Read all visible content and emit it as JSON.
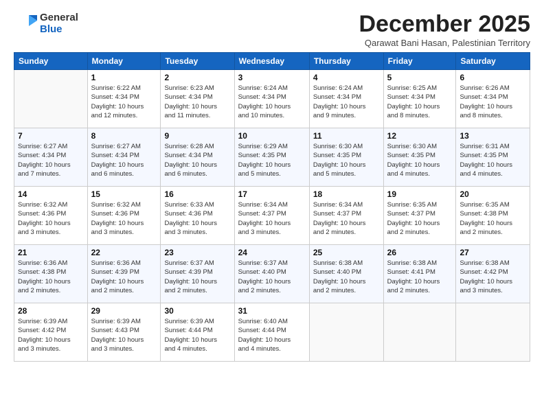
{
  "logo": {
    "general": "General",
    "blue": "Blue"
  },
  "title": "December 2025",
  "location": "Qarawat Bani Hasan, Palestinian Territory",
  "days_of_week": [
    "Sunday",
    "Monday",
    "Tuesday",
    "Wednesday",
    "Thursday",
    "Friday",
    "Saturday"
  ],
  "weeks": [
    [
      {
        "day": "",
        "info": ""
      },
      {
        "day": "1",
        "info": "Sunrise: 6:22 AM\nSunset: 4:34 PM\nDaylight: 10 hours\nand 12 minutes."
      },
      {
        "day": "2",
        "info": "Sunrise: 6:23 AM\nSunset: 4:34 PM\nDaylight: 10 hours\nand 11 minutes."
      },
      {
        "day": "3",
        "info": "Sunrise: 6:24 AM\nSunset: 4:34 PM\nDaylight: 10 hours\nand 10 minutes."
      },
      {
        "day": "4",
        "info": "Sunrise: 6:24 AM\nSunset: 4:34 PM\nDaylight: 10 hours\nand 9 minutes."
      },
      {
        "day": "5",
        "info": "Sunrise: 6:25 AM\nSunset: 4:34 PM\nDaylight: 10 hours\nand 8 minutes."
      },
      {
        "day": "6",
        "info": "Sunrise: 6:26 AM\nSunset: 4:34 PM\nDaylight: 10 hours\nand 8 minutes."
      }
    ],
    [
      {
        "day": "7",
        "info": "Sunrise: 6:27 AM\nSunset: 4:34 PM\nDaylight: 10 hours\nand 7 minutes."
      },
      {
        "day": "8",
        "info": "Sunrise: 6:27 AM\nSunset: 4:34 PM\nDaylight: 10 hours\nand 6 minutes."
      },
      {
        "day": "9",
        "info": "Sunrise: 6:28 AM\nSunset: 4:34 PM\nDaylight: 10 hours\nand 6 minutes."
      },
      {
        "day": "10",
        "info": "Sunrise: 6:29 AM\nSunset: 4:35 PM\nDaylight: 10 hours\nand 5 minutes."
      },
      {
        "day": "11",
        "info": "Sunrise: 6:30 AM\nSunset: 4:35 PM\nDaylight: 10 hours\nand 5 minutes."
      },
      {
        "day": "12",
        "info": "Sunrise: 6:30 AM\nSunset: 4:35 PM\nDaylight: 10 hours\nand 4 minutes."
      },
      {
        "day": "13",
        "info": "Sunrise: 6:31 AM\nSunset: 4:35 PM\nDaylight: 10 hours\nand 4 minutes."
      }
    ],
    [
      {
        "day": "14",
        "info": "Sunrise: 6:32 AM\nSunset: 4:36 PM\nDaylight: 10 hours\nand 3 minutes."
      },
      {
        "day": "15",
        "info": "Sunrise: 6:32 AM\nSunset: 4:36 PM\nDaylight: 10 hours\nand 3 minutes."
      },
      {
        "day": "16",
        "info": "Sunrise: 6:33 AM\nSunset: 4:36 PM\nDaylight: 10 hours\nand 3 minutes."
      },
      {
        "day": "17",
        "info": "Sunrise: 6:34 AM\nSunset: 4:37 PM\nDaylight: 10 hours\nand 3 minutes."
      },
      {
        "day": "18",
        "info": "Sunrise: 6:34 AM\nSunset: 4:37 PM\nDaylight: 10 hours\nand 2 minutes."
      },
      {
        "day": "19",
        "info": "Sunrise: 6:35 AM\nSunset: 4:37 PM\nDaylight: 10 hours\nand 2 minutes."
      },
      {
        "day": "20",
        "info": "Sunrise: 6:35 AM\nSunset: 4:38 PM\nDaylight: 10 hours\nand 2 minutes."
      }
    ],
    [
      {
        "day": "21",
        "info": "Sunrise: 6:36 AM\nSunset: 4:38 PM\nDaylight: 10 hours\nand 2 minutes."
      },
      {
        "day": "22",
        "info": "Sunrise: 6:36 AM\nSunset: 4:39 PM\nDaylight: 10 hours\nand 2 minutes."
      },
      {
        "day": "23",
        "info": "Sunrise: 6:37 AM\nSunset: 4:39 PM\nDaylight: 10 hours\nand 2 minutes."
      },
      {
        "day": "24",
        "info": "Sunrise: 6:37 AM\nSunset: 4:40 PM\nDaylight: 10 hours\nand 2 minutes."
      },
      {
        "day": "25",
        "info": "Sunrise: 6:38 AM\nSunset: 4:40 PM\nDaylight: 10 hours\nand 2 minutes."
      },
      {
        "day": "26",
        "info": "Sunrise: 6:38 AM\nSunset: 4:41 PM\nDaylight: 10 hours\nand 2 minutes."
      },
      {
        "day": "27",
        "info": "Sunrise: 6:38 AM\nSunset: 4:42 PM\nDaylight: 10 hours\nand 3 minutes."
      }
    ],
    [
      {
        "day": "28",
        "info": "Sunrise: 6:39 AM\nSunset: 4:42 PM\nDaylight: 10 hours\nand 3 minutes."
      },
      {
        "day": "29",
        "info": "Sunrise: 6:39 AM\nSunset: 4:43 PM\nDaylight: 10 hours\nand 3 minutes."
      },
      {
        "day": "30",
        "info": "Sunrise: 6:39 AM\nSunset: 4:44 PM\nDaylight: 10 hours\nand 4 minutes."
      },
      {
        "day": "31",
        "info": "Sunrise: 6:40 AM\nSunset: 4:44 PM\nDaylight: 10 hours\nand 4 minutes."
      },
      {
        "day": "",
        "info": ""
      },
      {
        "day": "",
        "info": ""
      },
      {
        "day": "",
        "info": ""
      }
    ]
  ]
}
